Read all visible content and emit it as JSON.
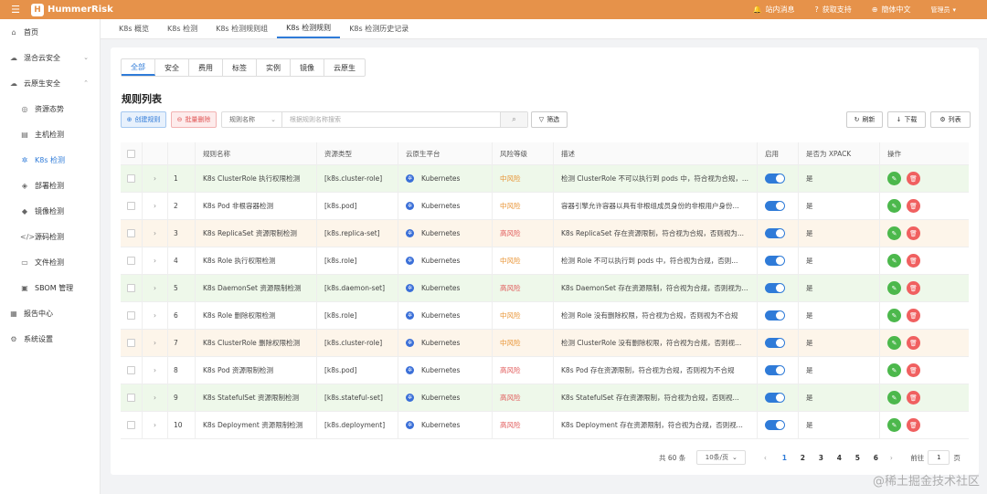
{
  "app": {
    "name": "HummerRisk",
    "logo_letter": "H"
  },
  "header": {
    "actions": [
      {
        "icon": "bell-icon",
        "glyph": "🔔",
        "label": "站内消息"
      },
      {
        "icon": "help-icon",
        "glyph": "?",
        "label": "获取支持"
      },
      {
        "icon": "globe-icon",
        "glyph": "⊕",
        "label": "簡体中文"
      }
    ],
    "user": "管理员"
  },
  "sidebar": {
    "items": [
      {
        "label": "首页",
        "glyph": "⌂",
        "icon": "home-icon",
        "sub": false,
        "caret": ""
      },
      {
        "label": "混合云安全",
        "glyph": "☁",
        "icon": "cloud-icon",
        "sub": false,
        "caret": "⌄"
      },
      {
        "label": "云原生安全",
        "glyph": "☁",
        "icon": "cloud-native-icon",
        "sub": false,
        "caret": "⌃"
      },
      {
        "label": "资源态势",
        "glyph": "◎",
        "icon": "radar-icon",
        "sub": true,
        "caret": ""
      },
      {
        "label": "主机检测",
        "glyph": "▤",
        "icon": "host-icon",
        "sub": true,
        "caret": ""
      },
      {
        "label": "K8s 检测",
        "glyph": "✲",
        "icon": "k8s-icon",
        "sub": true,
        "caret": "",
        "active": true
      },
      {
        "label": "部署检测",
        "glyph": "◈",
        "icon": "deploy-icon",
        "sub": true,
        "caret": ""
      },
      {
        "label": "镜像检测",
        "glyph": "◆",
        "icon": "image-icon",
        "sub": true,
        "caret": ""
      },
      {
        "label": "源码检测",
        "glyph": "</>",
        "icon": "code-icon",
        "sub": true,
        "caret": ""
      },
      {
        "label": "文件检测",
        "glyph": "▭",
        "icon": "file-icon",
        "sub": true,
        "caret": ""
      },
      {
        "label": "SBOM 管理",
        "glyph": "▣",
        "icon": "sbom-icon",
        "sub": true,
        "caret": ""
      },
      {
        "label": "报告中心",
        "glyph": "▦",
        "icon": "report-icon",
        "sub": false,
        "caret": ""
      },
      {
        "label": "系统设置",
        "glyph": "⚙",
        "icon": "gear-icon",
        "sub": false,
        "caret": ""
      }
    ]
  },
  "page_tabs": [
    {
      "label": "K8s 概览"
    },
    {
      "label": "K8s 检测"
    },
    {
      "label": "K8s 检测规则组"
    },
    {
      "label": "K8s 检测规则",
      "active": true
    },
    {
      "label": "K8s 检测历史记录"
    }
  ],
  "filter_tabs": [
    "全部",
    "安全",
    "费用",
    "标签",
    "实例",
    "镜像",
    "云原生"
  ],
  "section_title": "规则列表",
  "toolbar": {
    "create_label": "创建规则",
    "delete_label": "批量删除",
    "search_field": "规则名称",
    "search_placeholder": "根据规则名称搜索",
    "filter_label": "筛选",
    "refresh_label": "刷新",
    "download_label": "下载",
    "columns_label": "列表"
  },
  "table": {
    "headers": {
      "name": "规则名称",
      "type": "资源类型",
      "platform": "云原生平台",
      "risk": "风险等级",
      "desc": "描述",
      "enabled": "启用",
      "xpack": "是否为 XPACK",
      "ops": "操作"
    },
    "rows": [
      {
        "idx": "1",
        "name": "K8s ClusterRole 执行权限检测",
        "type": "[k8s.cluster-role]",
        "platform": "Kubernetes",
        "risk": "中风险",
        "level": "mid",
        "desc": "检测 ClusterRole 不可以执行到 pods 中，符合视为合规，...",
        "xpack": "是",
        "tint": "green"
      },
      {
        "idx": "2",
        "name": "K8s Pod 非根容器检测",
        "type": "[k8s.pod]",
        "platform": "Kubernetes",
        "risk": "中风险",
        "level": "mid",
        "desc": "容器引擎允许容器以具有非根组成员身份的非根用户身份...",
        "xpack": "是",
        "tint": ""
      },
      {
        "idx": "3",
        "name": "K8s ReplicaSet 资源限制检测",
        "type": "[k8s.replica-set]",
        "platform": "Kubernetes",
        "risk": "高风险",
        "level": "high",
        "desc": "K8s ReplicaSet 存在资源限制，符合视为合规，否则视为...",
        "xpack": "是",
        "tint": "orange"
      },
      {
        "idx": "4",
        "name": "K8s Role 执行权限检测",
        "type": "[k8s.role]",
        "platform": "Kubernetes",
        "risk": "中风险",
        "level": "mid",
        "desc": "检测 Role 不可以执行到 pods 中，符合视为合规，否则...",
        "xpack": "是",
        "tint": ""
      },
      {
        "idx": "5",
        "name": "K8s DaemonSet 资源限制检测",
        "type": "[k8s.daemon-set]",
        "platform": "Kubernetes",
        "risk": "高风险",
        "level": "high",
        "desc": "K8s DaemonSet 存在资源限制，符合视为合规，否则视为...",
        "xpack": "是",
        "tint": "green"
      },
      {
        "idx": "6",
        "name": "K8s Role 删除权限检测",
        "type": "[k8s.role]",
        "platform": "Kubernetes",
        "risk": "中风险",
        "level": "mid",
        "desc": "检测 Role 没有删除权限，符合视为合规，否则视为不合规",
        "xpack": "是",
        "tint": ""
      },
      {
        "idx": "7",
        "name": "K8s ClusterRole 删除权限检测",
        "type": "[k8s.cluster-role]",
        "platform": "Kubernetes",
        "risk": "中风险",
        "level": "mid",
        "desc": "检测 ClusterRole 没有删除权限，符合视为合规，否则视...",
        "xpack": "是",
        "tint": "orange"
      },
      {
        "idx": "8",
        "name": "K8s Pod 资源限制检测",
        "type": "[k8s.pod]",
        "platform": "Kubernetes",
        "risk": "高风险",
        "level": "high",
        "desc": "K8s Pod 存在资源限制，符合视为合规，否则视为不合规",
        "xpack": "是",
        "tint": ""
      },
      {
        "idx": "9",
        "name": "K8s StatefulSet 资源限制检测",
        "type": "[k8s.stateful-set]",
        "platform": "Kubernetes",
        "risk": "高风险",
        "level": "high",
        "desc": "K8s StatefulSet 存在资源限制，符合视为合规，否则视...",
        "xpack": "是",
        "tint": "green"
      },
      {
        "idx": "10",
        "name": "K8s Deployment 资源限制检测",
        "type": "[k8s.deployment]",
        "platform": "Kubernetes",
        "risk": "高风险",
        "level": "high",
        "desc": "K8s Deployment 存在资源限制，符合视为合规，否则视...",
        "xpack": "是",
        "tint": ""
      }
    ]
  },
  "pagination": {
    "total": "共 60 条",
    "page_size": "10条/页",
    "pages": [
      "1",
      "2",
      "3",
      "4",
      "5",
      "6"
    ],
    "current": "1",
    "goto_label": "前往",
    "goto_value": "1",
    "goto_suffix": "页"
  },
  "watermark": "@稀土掘金技术社区",
  "colors": {
    "accent": "#2f7bd8",
    "brand": "#e6924a",
    "risk_mid": "#e8912f",
    "risk_high": "#e05555"
  }
}
